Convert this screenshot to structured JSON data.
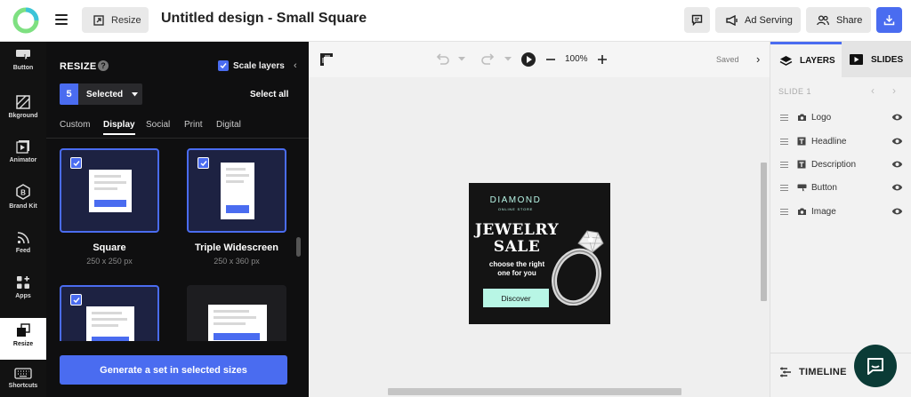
{
  "topbar": {
    "resize_label": "Resize",
    "title": "Untitled design - Small Square",
    "ad_serving_label": "Ad Serving",
    "share_label": "Share"
  },
  "rail": {
    "items": [
      {
        "label": "Button",
        "icon": "button-icon"
      },
      {
        "label": "Bkground",
        "icon": "background-icon"
      },
      {
        "label": "Animator",
        "icon": "animator-icon"
      },
      {
        "label": "Brand Kit",
        "icon": "brand-kit-icon"
      },
      {
        "label": "Feed",
        "icon": "feed-icon"
      },
      {
        "label": "Apps",
        "icon": "apps-icon"
      },
      {
        "label": "Resize",
        "icon": "resize-icon",
        "active": true
      },
      {
        "label": "Shortcuts",
        "icon": "keyboard-icon"
      }
    ]
  },
  "panel": {
    "title": "RESIZE",
    "scale_layers_label": "Scale layers",
    "scale_layers_checked": true,
    "selected_count": "5",
    "selected_label": "Selected",
    "select_all_label": "Select all",
    "tabs": [
      {
        "label": "Custom",
        "active": false
      },
      {
        "label": "Display",
        "active": true
      },
      {
        "label": "Social",
        "active": false
      },
      {
        "label": "Print",
        "active": false
      },
      {
        "label": "Digital",
        "active": false
      }
    ],
    "cards": [
      {
        "name": "Square",
        "dims": "250 x 250 px",
        "checked": true
      },
      {
        "name": "Triple Widescreen",
        "dims": "250 x 360 px",
        "checked": true
      },
      {
        "name": "",
        "dims": "",
        "checked": true
      },
      {
        "name": "",
        "dims": "",
        "checked": false
      }
    ],
    "generate_label": "Generate a set in selected sizes"
  },
  "canvas": {
    "zoom": "100%",
    "saved_label": "Saved",
    "design": {
      "brand": "DIAMOND",
      "brand_sub": "ONLINE STORE",
      "headline_line1": "JEWELRY",
      "headline_line2": "SALE",
      "desc_line1": "choose the right",
      "desc_line2": "one for you",
      "button": "Discover"
    }
  },
  "layers_panel": {
    "layers_tab": "LAYERS",
    "slides_tab": "SLIDES",
    "slide_label": "SLIDE 1",
    "layers": [
      {
        "name": "Logo",
        "icon": "camera-icon"
      },
      {
        "name": "Headline",
        "icon": "text-icon"
      },
      {
        "name": "Description",
        "icon": "text-icon"
      },
      {
        "name": "Button",
        "icon": "button-icon"
      },
      {
        "name": "Image",
        "icon": "camera-icon"
      }
    ],
    "timeline_label": "TIMELINE"
  },
  "colors": {
    "accent": "#4a6cf0",
    "panel_bg": "#0f0f10",
    "mint": "#b8f6e5"
  }
}
